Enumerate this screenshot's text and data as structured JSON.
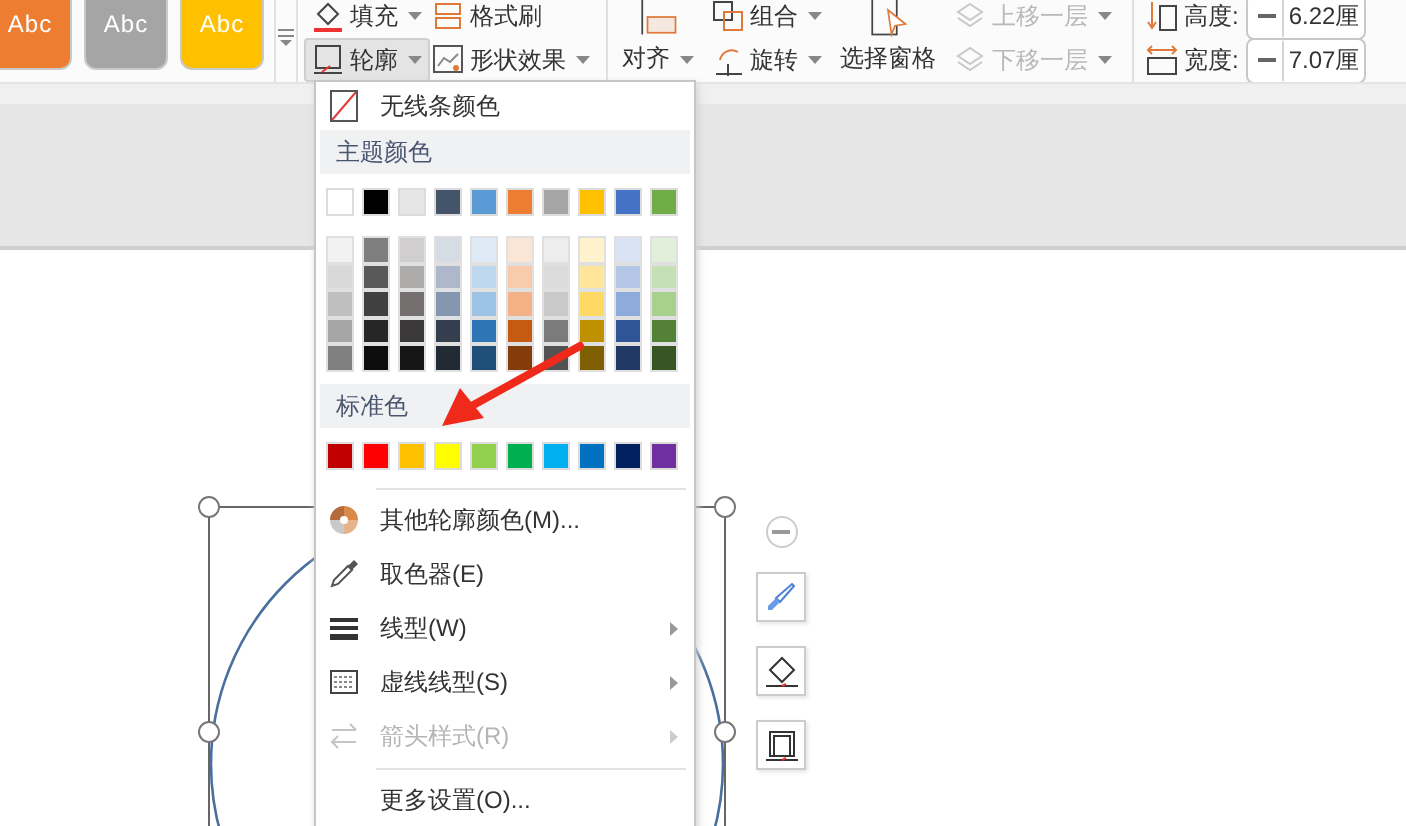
{
  "ribbon": {
    "style_tiles": [
      {
        "label": "Abc",
        "color": "#ed7d31"
      },
      {
        "label": "Abc",
        "color": "#a5a5a5"
      },
      {
        "label": "Abc",
        "color": "#ffc000"
      }
    ],
    "format_buttons": [
      {
        "label": "填充",
        "dropdown": true,
        "selected": false
      },
      {
        "label": "格式刷",
        "dropdown": false,
        "selected": false
      },
      {
        "label": "轮廓",
        "dropdown": true,
        "selected": true
      },
      {
        "label": "形状效果",
        "dropdown": true,
        "selected": false
      }
    ],
    "align_button": {
      "label": "对齐"
    },
    "arrange_buttons": [
      {
        "label": "组合"
      },
      {
        "label": "旋转"
      }
    ],
    "selection_pane_button": {
      "label": "选择窗格"
    },
    "layer_buttons": [
      {
        "label": "上移一层",
        "disabled": true
      },
      {
        "label": "下移一层",
        "disabled": true
      }
    ],
    "size_fields": [
      {
        "label": "高度:",
        "value": "6.22厘"
      },
      {
        "label": "宽度:",
        "value": "7.07厘"
      }
    ]
  },
  "outline_menu": {
    "no_line_item": {
      "label": "无线条颜色"
    },
    "theme_header": "主题颜色",
    "theme_colors": [
      {
        "color": "#ffffff"
      },
      {
        "color": "#000000"
      },
      {
        "color": "#e7e6e6"
      },
      {
        "color": "#44546a"
      },
      {
        "color": "#5b9bd5"
      },
      {
        "color": "#ed7d31"
      },
      {
        "color": "#a5a5a5"
      },
      {
        "color": "#ffc000"
      },
      {
        "color": "#4472c4"
      },
      {
        "color": "#70ad47"
      }
    ],
    "theme_shades": [
      {
        "shades": [
          {
            "color": "#f2f2f2"
          },
          {
            "color": "#d9d9d9"
          },
          {
            "color": "#bfbfbf"
          },
          {
            "color": "#a6a6a6"
          },
          {
            "color": "#808080"
          }
        ]
      },
      {
        "shades": [
          {
            "color": "#7f7f7f"
          },
          {
            "color": "#595959"
          },
          {
            "color": "#404040"
          },
          {
            "color": "#262626"
          },
          {
            "color": "#0d0d0d"
          }
        ]
      },
      {
        "shades": [
          {
            "color": "#d0cece"
          },
          {
            "color": "#aeabab"
          },
          {
            "color": "#757070"
          },
          {
            "color": "#3a3838"
          },
          {
            "color": "#171616"
          }
        ]
      },
      {
        "shades": [
          {
            "color": "#d6dce4"
          },
          {
            "color": "#adb9ca"
          },
          {
            "color": "#8496b0"
          },
          {
            "color": "#333f4f"
          },
          {
            "color": "#222a35"
          }
        ]
      },
      {
        "shades": [
          {
            "color": "#deebf6"
          },
          {
            "color": "#bdd7ee"
          },
          {
            "color": "#9dc3e6"
          },
          {
            "color": "#2e75b5"
          },
          {
            "color": "#1f4e79"
          }
        ]
      },
      {
        "shades": [
          {
            "color": "#fbe5d5"
          },
          {
            "color": "#f8cbad"
          },
          {
            "color": "#f4b183"
          },
          {
            "color": "#c55a11"
          },
          {
            "color": "#843c0b"
          }
        ]
      },
      {
        "shades": [
          {
            "color": "#ededed"
          },
          {
            "color": "#dbdbdb"
          },
          {
            "color": "#c9c9c9"
          },
          {
            "color": "#7b7b7b"
          },
          {
            "color": "#525252"
          }
        ]
      },
      {
        "shades": [
          {
            "color": "#fff2cc"
          },
          {
            "color": "#ffe699"
          },
          {
            "color": "#ffd966"
          },
          {
            "color": "#bf9000"
          },
          {
            "color": "#7f6000"
          }
        ]
      },
      {
        "shades": [
          {
            "color": "#dae3f3"
          },
          {
            "color": "#b4c7e7"
          },
          {
            "color": "#8faadc"
          },
          {
            "color": "#2f5597"
          },
          {
            "color": "#203864"
          }
        ]
      },
      {
        "shades": [
          {
            "color": "#e2efda"
          },
          {
            "color": "#c5e0b4"
          },
          {
            "color": "#a9d18e"
          },
          {
            "color": "#538135"
          },
          {
            "color": "#375623"
          }
        ]
      }
    ],
    "standard_header": "标准色",
    "standard_colors": [
      {
        "color": "#c00000"
      },
      {
        "color": "#ff0000"
      },
      {
        "color": "#ffc000"
      },
      {
        "color": "#ffff00"
      },
      {
        "color": "#92d050"
      },
      {
        "color": "#00b050"
      },
      {
        "color": "#00b0f0"
      },
      {
        "color": "#0070c0"
      },
      {
        "color": "#002060"
      },
      {
        "color": "#7030a0"
      }
    ],
    "commands": [
      {
        "label": "其他轮廓颜色(M)...",
        "submenu": false,
        "disabled": false
      },
      {
        "label": "取色器(E)",
        "submenu": false,
        "disabled": false
      },
      {
        "label": "线型(W)",
        "submenu": true,
        "disabled": false
      },
      {
        "label": "虚线线型(S)",
        "submenu": true,
        "disabled": false
      },
      {
        "label": "箭头样式(R)",
        "submenu": true,
        "disabled": true
      }
    ],
    "more_item": {
      "label": "更多设置(O)..."
    }
  }
}
